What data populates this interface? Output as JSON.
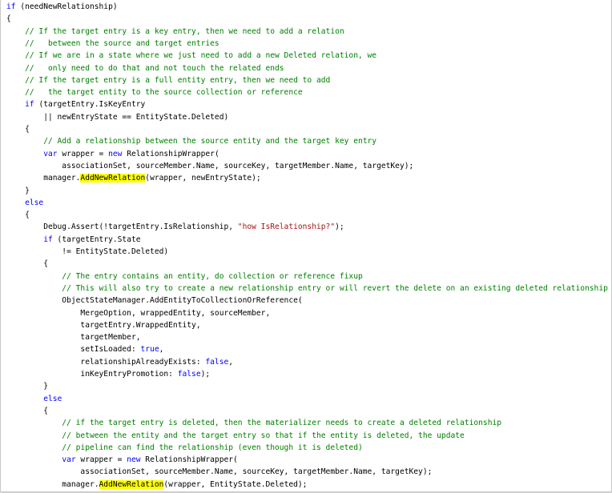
{
  "colors": {
    "plain": "#000000",
    "keyword": "#0000ff",
    "comment": "#008000",
    "string": "#a31515",
    "highlight": "#ffff00",
    "background": "#ffffff"
  },
  "lines": [
    [
      {
        "t": "if",
        "c": "kw"
      },
      {
        "t": " (needNewRelationship)"
      }
    ],
    [
      {
        "t": "{"
      }
    ],
    [
      {
        "t": "    // If the target entry is a key entry, then we need to add a relation",
        "c": "cm"
      }
    ],
    [
      {
        "t": "    //   between the source and target entries",
        "c": "cm"
      }
    ],
    [
      {
        "t": "    // If we are in a state where we just need to add a new Deleted relation, we",
        "c": "cm"
      }
    ],
    [
      {
        "t": "    //   only need to do that and not touch the related ends",
        "c": "cm"
      }
    ],
    [
      {
        "t": "    // If the target entry is a full entity entry, then we need to add",
        "c": "cm"
      }
    ],
    [
      {
        "t": "    //   the target entity to the source collection or reference",
        "c": "cm"
      }
    ],
    [
      {
        "t": "    "
      },
      {
        "t": "if",
        "c": "kw"
      },
      {
        "t": " (targetEntry.IsKeyEntry"
      }
    ],
    [
      {
        "t": "        || newEntryState == EntityState.Deleted)"
      }
    ],
    [
      {
        "t": "    {"
      }
    ],
    [
      {
        "t": "        // Add a relationship between the source entity and the target key entry",
        "c": "cm"
      }
    ],
    [
      {
        "t": "        "
      },
      {
        "t": "var",
        "c": "kw"
      },
      {
        "t": " wrapper = "
      },
      {
        "t": "new",
        "c": "kw"
      },
      {
        "t": " RelationshipWrapper("
      }
    ],
    [
      {
        "t": "            associationSet, sourceMember.Name, sourceKey, targetMember.Name, targetKey);"
      }
    ],
    [
      {
        "t": "        manager."
      },
      {
        "t": "AddNewRelation",
        "c": "hl"
      },
      {
        "t": "(wrapper, newEntryState);"
      }
    ],
    [
      {
        "t": "    }"
      }
    ],
    [
      {
        "t": "    "
      },
      {
        "t": "else",
        "c": "kw"
      }
    ],
    [
      {
        "t": "    {"
      }
    ],
    [
      {
        "t": "        Debug.Assert(!targetEntry.IsRelationship, "
      },
      {
        "t": "\"how IsRelationship?\"",
        "c": "st"
      },
      {
        "t": ");"
      }
    ],
    [
      {
        "t": "        "
      },
      {
        "t": "if",
        "c": "kw"
      },
      {
        "t": " (targetEntry.State"
      }
    ],
    [
      {
        "t": "            != EntityState.Deleted)"
      }
    ],
    [
      {
        "t": "        {"
      }
    ],
    [
      {
        "t": "            // The entry contains an entity, do collection or reference fixup",
        "c": "cm"
      }
    ],
    [
      {
        "t": "            // This will also try to create a new relationship entry or will revert the delete on an existing deleted relationship",
        "c": "cm"
      }
    ],
    [
      {
        "t": "            ObjectStateManager.AddEntityToCollectionOrReference("
      }
    ],
    [
      {
        "t": "                MergeOption, wrappedEntity, sourceMember,"
      }
    ],
    [
      {
        "t": "                targetEntry.WrappedEntity,"
      }
    ],
    [
      {
        "t": "                targetMember,"
      }
    ],
    [
      {
        "t": "                setIsLoaded: "
      },
      {
        "t": "true",
        "c": "kw"
      },
      {
        "t": ","
      }
    ],
    [
      {
        "t": "                relationshipAlreadyExists: "
      },
      {
        "t": "false",
        "c": "kw"
      },
      {
        "t": ","
      }
    ],
    [
      {
        "t": "                inKeyEntryPromotion: "
      },
      {
        "t": "false",
        "c": "kw"
      },
      {
        "t": ");"
      }
    ],
    [
      {
        "t": "        }"
      }
    ],
    [
      {
        "t": "        "
      },
      {
        "t": "else",
        "c": "kw"
      }
    ],
    [
      {
        "t": "        {"
      }
    ],
    [
      {
        "t": "            // if the target entry is deleted, then the materializer needs to create a deleted relationship",
        "c": "cm"
      }
    ],
    [
      {
        "t": "            // between the entity and the target entry so that if the entity is deleted, the update",
        "c": "cm"
      }
    ],
    [
      {
        "t": "            // pipeline can find the relationship (even though it is deleted)",
        "c": "cm"
      }
    ],
    [
      {
        "t": "            "
      },
      {
        "t": "var",
        "c": "kw"
      },
      {
        "t": " wrapper = "
      },
      {
        "t": "new",
        "c": "kw"
      },
      {
        "t": " RelationshipWrapper("
      }
    ],
    [
      {
        "t": "                associationSet, sourceMember.Name, sourceKey, targetMember.Name, targetKey);"
      }
    ],
    [
      {
        "t": "            manager."
      },
      {
        "t": "AddNewRelation",
        "c": "hl"
      },
      {
        "t": "(wrapper, EntityState.Deleted);"
      }
    ]
  ]
}
